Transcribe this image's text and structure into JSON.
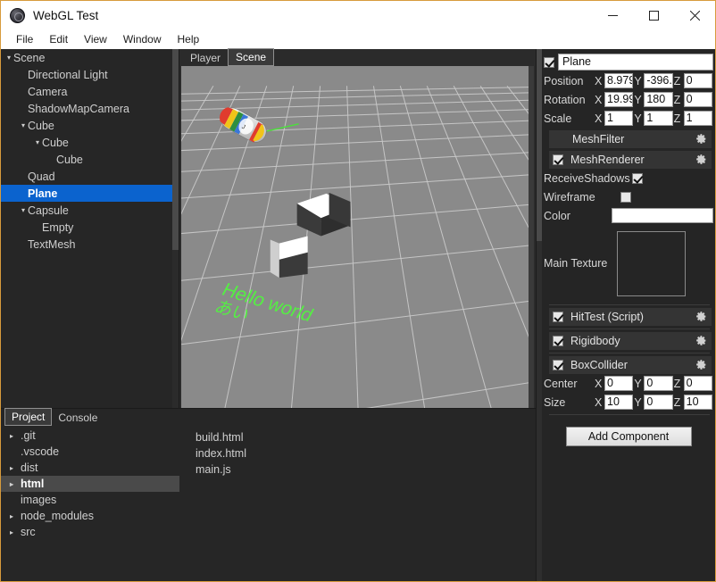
{
  "window": {
    "title": "WebGL Test",
    "icon": "app-globe-icon",
    "minimize": "─",
    "maximize": "□",
    "close": "✕",
    "border_color": "#d79b3c"
  },
  "menubar": {
    "items": [
      {
        "label": "File"
      },
      {
        "label": "Edit"
      },
      {
        "label": "View"
      },
      {
        "label": "Window"
      },
      {
        "label": "Help"
      }
    ]
  },
  "hierarchy": {
    "items": [
      {
        "label": "Scene",
        "depth": 0,
        "arrow": "▾",
        "selected": false
      },
      {
        "label": "Directional Light",
        "depth": 1,
        "arrow": "",
        "selected": false
      },
      {
        "label": "Camera",
        "depth": 1,
        "arrow": "",
        "selected": false
      },
      {
        "label": "ShadowMapCamera",
        "depth": 1,
        "arrow": "",
        "selected": false
      },
      {
        "label": "Cube",
        "depth": 1,
        "arrow": "▾",
        "selected": false
      },
      {
        "label": "Cube",
        "depth": 2,
        "arrow": "▾",
        "selected": false
      },
      {
        "label": "Cube",
        "depth": 3,
        "arrow": "",
        "selected": false
      },
      {
        "label": "Quad",
        "depth": 1,
        "arrow": "",
        "selected": false
      },
      {
        "label": "Plane",
        "depth": 1,
        "arrow": "",
        "selected": true
      },
      {
        "label": "Capsule",
        "depth": 1,
        "arrow": "▾",
        "selected": false
      },
      {
        "label": "Empty",
        "depth": 2,
        "arrow": "",
        "selected": false
      },
      {
        "label": "TextMesh",
        "depth": 1,
        "arrow": "",
        "selected": false
      }
    ]
  },
  "viewport": {
    "tabs": [
      {
        "label": "Player",
        "active": false
      },
      {
        "label": "Scene",
        "active": true
      }
    ],
    "scene": {
      "ground_color": "#8a8a8a",
      "grid_color": "#c9c9c9",
      "text_mesh": "Hello world",
      "text_mesh_sub": "あい",
      "text_color": "#55ee44",
      "objects": [
        "capsule",
        "cube",
        "cube",
        "text-mesh"
      ]
    }
  },
  "project": {
    "tabs": [
      {
        "label": "Project",
        "active": true
      },
      {
        "label": "Console",
        "active": false
      }
    ],
    "tree": [
      {
        "label": ".git",
        "arrow": "▸",
        "selected": false
      },
      {
        "label": ".vscode",
        "arrow": "",
        "selected": false
      },
      {
        "label": "dist",
        "arrow": "▸",
        "selected": false
      },
      {
        "label": "html",
        "arrow": "▸",
        "selected": true
      },
      {
        "label": "images",
        "arrow": "",
        "selected": false
      },
      {
        "label": "node_modules",
        "arrow": "▸",
        "selected": false
      },
      {
        "label": "src",
        "arrow": "▸",
        "selected": false
      }
    ],
    "files": [
      {
        "name": "build.html"
      },
      {
        "name": "index.html"
      },
      {
        "name": "main.js"
      }
    ]
  },
  "inspector": {
    "object": {
      "enabled": true,
      "name": "Plane"
    },
    "transform": {
      "rows": [
        {
          "label": "Position",
          "x": "8.979",
          "y": "-396.",
          "z": "0"
        },
        {
          "label": "Rotation",
          "x": "19.99",
          "y": "180",
          "z": "0"
        },
        {
          "label": "Scale",
          "x": "1",
          "y": "1",
          "z": "1"
        }
      ],
      "axis_x": "X",
      "axis_y": "Y",
      "axis_z": "Z"
    },
    "components": [
      {
        "title": "MeshFilter",
        "has_checkbox": false,
        "checked": false,
        "gear": "gear-icon"
      },
      {
        "title": "MeshRenderer",
        "has_checkbox": true,
        "checked": true,
        "gear": "gear-icon"
      },
      {
        "title": "HitTest (Script)",
        "has_checkbox": true,
        "checked": true,
        "gear": "gear-icon"
      },
      {
        "title": "Rigidbody",
        "has_checkbox": true,
        "checked": true,
        "gear": "gear-icon"
      },
      {
        "title": "BoxCollider",
        "has_checkbox": true,
        "checked": true,
        "gear": "gear-icon"
      }
    ],
    "mesh_renderer": {
      "receive_shadows_label": "ReceiveShadows",
      "receive_shadows": true,
      "wireframe_label": "Wireframe",
      "wireframe": false,
      "color_label": "Color",
      "color_value": "#ffffff",
      "main_texture_label": "Main Texture"
    },
    "box_collider": {
      "rows": [
        {
          "label": "Center",
          "x": "0",
          "y": "0",
          "z": "0"
        },
        {
          "label": "Size",
          "x": "10",
          "y": "0",
          "z": "10"
        }
      ]
    },
    "add_component_label": "Add Component"
  }
}
